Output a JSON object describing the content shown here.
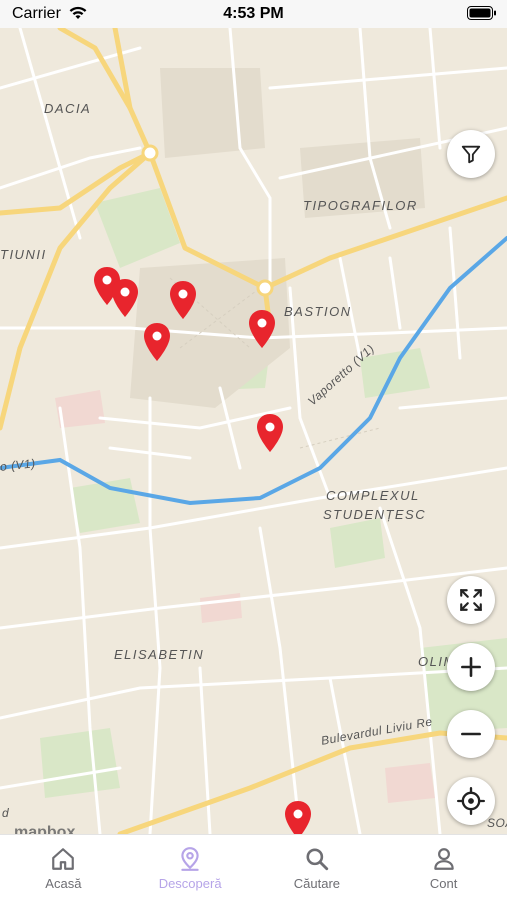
{
  "status_bar": {
    "carrier": "Carrier",
    "time": "4:53 PM"
  },
  "map": {
    "labels": {
      "dacia": "DACIA",
      "tipografilor": "TIPOGRAFILOR",
      "tiunii": "TIUNII",
      "bastion": "BASTION",
      "vaporetto_main": "Vaporetto (V1)",
      "vaporetto_left": "o (V1)",
      "complexul": "COMPLEXUL",
      "studentesc": "STUDENȚESC",
      "elisabetin": "ELISABETIN",
      "olim": "OLIM",
      "bulevardul": "Bulevardul Liviu Re",
      "d": "d",
      "soa": "SOA",
      "mapbox": "mapbox"
    },
    "pin_color": "#e8252d",
    "pin_count": 7,
    "river_color": "#5aa7e6",
    "road_color": "#f7d67c",
    "controls": [
      "filter-icon",
      "fullscreen-icon",
      "plus-icon",
      "minus-icon",
      "locate-icon"
    ]
  },
  "tab_bar": {
    "accent": "#b6a4e8",
    "items": [
      {
        "label": "Acasă",
        "icon": "home-icon",
        "active": false
      },
      {
        "label": "Descoperă",
        "icon": "map-pin-icon",
        "active": true
      },
      {
        "label": "Căutare",
        "icon": "search-icon",
        "active": false
      },
      {
        "label": "Cont",
        "icon": "user-icon",
        "active": false
      }
    ]
  }
}
